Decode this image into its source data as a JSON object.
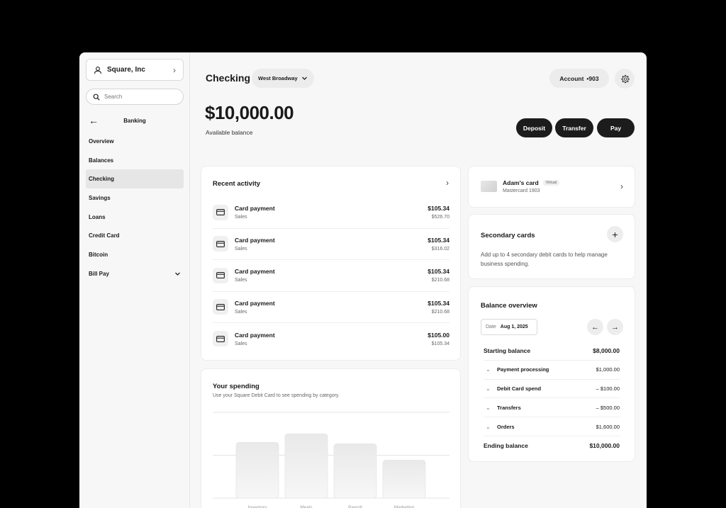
{
  "sidebar": {
    "org_name": "Square, Inc",
    "search_placeholder": "Search",
    "section_title": "Banking",
    "items": [
      {
        "label": "Overview"
      },
      {
        "label": "Balances"
      },
      {
        "label": "Checking",
        "active": true
      },
      {
        "label": "Savings"
      },
      {
        "label": "Loans"
      },
      {
        "label": "Credit Card"
      },
      {
        "label": "Bitcoin"
      },
      {
        "label": "Bill Pay",
        "has_caret": true
      }
    ]
  },
  "header": {
    "title": "Checking",
    "location": "West Broadway",
    "account_label": "Account",
    "account_number": "•903",
    "balance": "$10,000.00",
    "balance_label": "Available balance",
    "actions": {
      "deposit": "Deposit",
      "transfer": "Transfer",
      "pay": "Pay"
    }
  },
  "activity": {
    "title": "Recent activity",
    "items": [
      {
        "name": "Card payment",
        "sub": "Sales",
        "amount": "$105.34",
        "balance": "$526.70"
      },
      {
        "name": "Card payment",
        "sub": "Sales",
        "amount": "$105.34",
        "balance": "$316.02"
      },
      {
        "name": "Card payment",
        "sub": "Sales",
        "amount": "$105.34",
        "balance": "$210.68"
      },
      {
        "name": "Card payment",
        "sub": "Sales",
        "amount": "$105.34",
        "balance": "$210.68"
      },
      {
        "name": "Card payment",
        "sub": "Sales",
        "amount": "$105.00",
        "balance": "$105.34"
      }
    ]
  },
  "spending": {
    "title": "Your spending",
    "description": "Use your Square Debit Card to see spending by category."
  },
  "chart_data": {
    "type": "bar",
    "categories": [
      "Inventory",
      "Meals",
      "Payroll",
      "Marketing"
    ],
    "values": [
      78,
      90,
      76,
      53
    ],
    "ylim": [
      0,
      120
    ],
    "grid": true
  },
  "card": {
    "name": "Adam's card",
    "badge": "Virtual",
    "sub": "Mastercard 1903"
  },
  "secondary": {
    "title": "Secondary cards",
    "description": "Add up to 4 secondary debit cards to help manage business spending."
  },
  "overview": {
    "title": "Balance overview",
    "date_label": "Date",
    "date_value": "Aug 1, 2025",
    "starting": {
      "label": "Starting balance",
      "value": "$8,000.00"
    },
    "rows": [
      {
        "label": "Payment processing",
        "value": "$1,000.00"
      },
      {
        "label": "Debit Card spend",
        "value": "– $100.00"
      },
      {
        "label": "Transfers",
        "value": "– $500.00"
      },
      {
        "label": "Orders",
        "value": "$1,600.00"
      }
    ],
    "ending": {
      "label": "Ending balance",
      "value": "$10,000.00"
    }
  },
  "colors": {
    "accent": "#1c1c1c",
    "background": "#f7f7f7",
    "card": "#ffffff"
  }
}
